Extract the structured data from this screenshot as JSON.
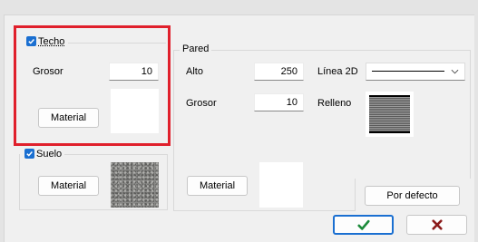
{
  "techo": {
    "label": "Techo",
    "checked": true,
    "grosor_label": "Grosor",
    "grosor_value": "10",
    "material_button": "Material"
  },
  "suelo": {
    "label": "Suelo",
    "checked": true,
    "material_button": "Material"
  },
  "pared": {
    "label": "Pared",
    "alto_label": "Alto",
    "alto_value": "250",
    "grosor_label": "Grosor",
    "grosor_value": "10",
    "linea2d_label": "Línea 2D",
    "relleno_label": "Relleno",
    "material_button": "Material"
  },
  "buttons": {
    "por_defecto": "Por defecto",
    "ok_icon": "check-icon",
    "cancel_icon": "x-icon"
  },
  "colors": {
    "accent": "#1a6fd1",
    "highlight": "#e0202c",
    "ok": "#1b8a3a",
    "cancel": "#8b1a1a"
  }
}
